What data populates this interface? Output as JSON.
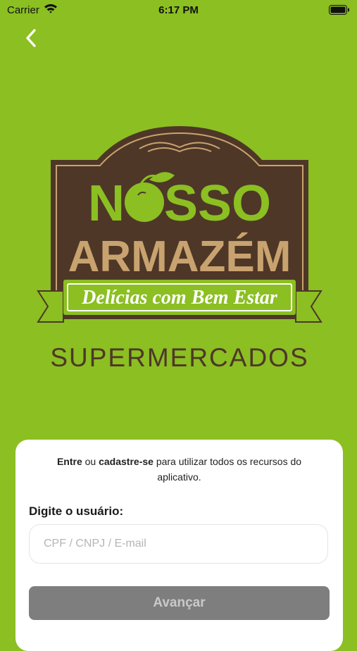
{
  "status_bar": {
    "carrier": "Carrier",
    "time": "6:17 PM"
  },
  "logo": {
    "line1": "NOSSO",
    "line2": "ARMAZÉM",
    "tagline": "Delícias com Bem Estar",
    "subtitle": "SUPERMERCADOS"
  },
  "sheet": {
    "intro_entre": "Entre",
    "intro_ou": " ou ",
    "intro_cadastre": "cadastre-se",
    "intro_rest": " para utilizar todos os recursos do aplicativo.",
    "user_label": "Digite o usuário:",
    "user_placeholder": "CPF / CNPJ / E-mail",
    "user_value": "",
    "next_label": "Avançar"
  },
  "colors": {
    "background": "#8bbf22",
    "brown": "#4e3727",
    "gold": "#c9a36f",
    "button": "#7e7e7e"
  }
}
